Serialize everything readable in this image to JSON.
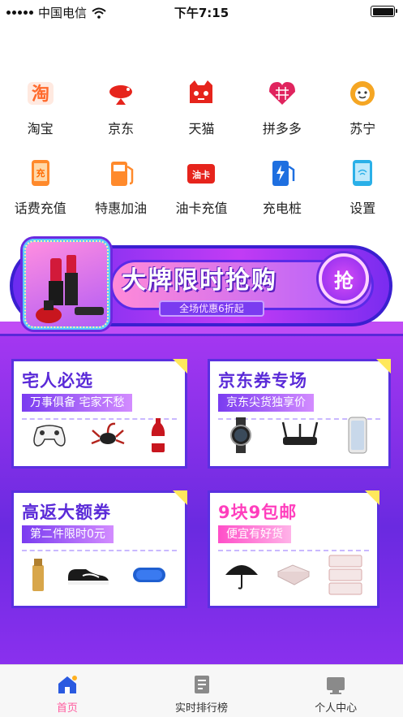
{
  "status_bar": {
    "carrier": "中国电信",
    "time": "下午7:15"
  },
  "shortcuts_row1": [
    {
      "label": "淘宝",
      "icon": "taobao-icon",
      "color": "#ff6a2c"
    },
    {
      "label": "京东",
      "icon": "jd-icon",
      "color": "#e6241c"
    },
    {
      "label": "天猫",
      "icon": "tmall-icon",
      "color": "#e6241c"
    },
    {
      "label": "拼多多",
      "icon": "pinduoduo-icon",
      "color": "#e0245e"
    },
    {
      "label": "苏宁",
      "icon": "suning-icon",
      "color": "#f5a623"
    }
  ],
  "shortcuts_row2": [
    {
      "label": "话费充值",
      "icon": "phone-recharge-icon",
      "color": "#ff8a2c"
    },
    {
      "label": "特惠加油",
      "icon": "fuel-icon",
      "color": "#ff8a2c"
    },
    {
      "label": "油卡充值",
      "icon": "fuel-card-icon",
      "color": "#e6241c"
    },
    {
      "label": "充电桩",
      "icon": "charging-pile-icon",
      "color": "#1e6fe0"
    },
    {
      "label": "设置",
      "icon": "settings-icon",
      "color": "#2ab0e8"
    }
  ],
  "promo": {
    "title": "大牌限时抢购",
    "subtitle": "全场优惠6折起",
    "grab_label": "抢"
  },
  "cards": [
    {
      "title": "宅人必选",
      "subtitle": "万事俱备 宅家不愁"
    },
    {
      "title": "京东券专场",
      "subtitle": "京东尖货独享价"
    },
    {
      "title": "高返大额券",
      "subtitle": "第二件限时0元"
    },
    {
      "title": "9块9包邮",
      "subtitle": "便宜有好货"
    }
  ],
  "tabbar": [
    {
      "label": "首页",
      "icon": "home-icon",
      "active": true
    },
    {
      "label": "实时排行榜",
      "icon": "ranking-icon",
      "active": false
    },
    {
      "label": "个人中心",
      "icon": "profile-icon",
      "active": false
    }
  ],
  "colors": {
    "accent": "#ff5a9e",
    "purple": "#6a2ae0",
    "card_title": "#5a2ad8"
  }
}
